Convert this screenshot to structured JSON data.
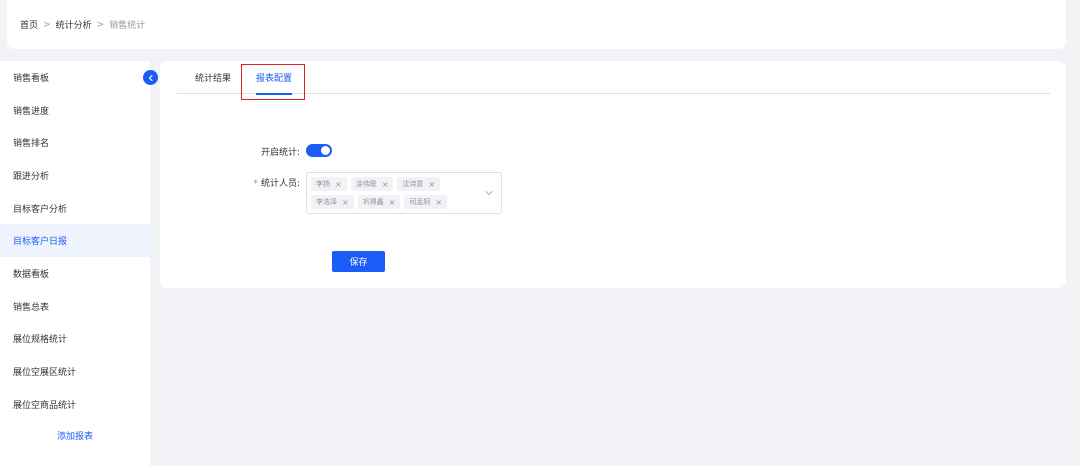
{
  "breadcrumb": {
    "items": [
      "首页",
      "统计分析",
      "销售统计"
    ],
    "separator": ">"
  },
  "sidebar": {
    "items": [
      {
        "label": "销售看板",
        "active": false
      },
      {
        "label": "销售进度",
        "active": false
      },
      {
        "label": "销售排名",
        "active": false
      },
      {
        "label": "跟进分析",
        "active": false
      },
      {
        "label": "目标客户分析",
        "active": false
      },
      {
        "label": "目标客户日报",
        "active": true
      },
      {
        "label": "数据看板",
        "active": false
      },
      {
        "label": "销售总表",
        "active": false
      },
      {
        "label": "展位规格统计",
        "active": false
      },
      {
        "label": "展位空展区统计",
        "active": false
      },
      {
        "label": "展位空商品统计",
        "active": false
      }
    ],
    "add_label": "添加报表",
    "collapse_icon": "chevron-left-icon"
  },
  "tabs": [
    {
      "label": "统计结果",
      "active": false
    },
    {
      "label": "报表配置",
      "active": true
    }
  ],
  "form": {
    "enable_label": "开启统计:",
    "enable_value": true,
    "staff_label": "统计人员:",
    "staff_required": "*",
    "staff_tags": [
      "李扬",
      "涂伟联",
      "沈诗意",
      "李浩泽",
      "巩得鑫",
      "司孟轲"
    ],
    "remove_glyph": "×"
  },
  "save_label": "保存",
  "colors": {
    "accent": "#1a5cf5",
    "highlight": "#e02020",
    "background": "#f2f3f7"
  }
}
